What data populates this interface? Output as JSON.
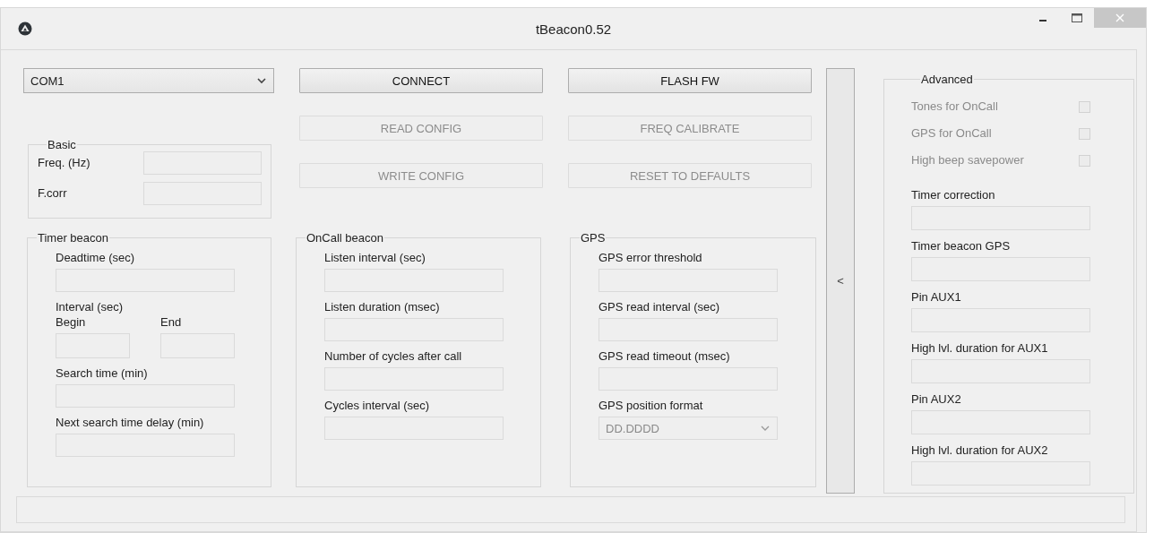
{
  "window": {
    "title": "tBeacon0.52"
  },
  "port": {
    "value": "COM1"
  },
  "buttons": [
    {
      "label": "CONNECT",
      "disabled": false
    },
    {
      "label": "FLASH FW",
      "disabled": false
    },
    {
      "label": "READ CONFIG",
      "disabled": true
    },
    {
      "label": "FREQ CALIBRATE",
      "disabled": true
    },
    {
      "label": "WRITE CONFIG",
      "disabled": true
    },
    {
      "label": "RESET TO DEFAULTS",
      "disabled": true
    }
  ],
  "basic": {
    "title": "Basic",
    "fields": [
      {
        "label": "Freq. (Hz)"
      },
      {
        "label": "F.corr"
      }
    ]
  },
  "timer_beacon": {
    "title": "Timer beacon",
    "fields": [
      {
        "kind": "field",
        "label": "Deadtime (sec)"
      },
      {
        "kind": "pair",
        "label": "Interval (sec)",
        "fields": [
          {
            "label": "Begin"
          },
          {
            "label": "End"
          }
        ]
      },
      {
        "kind": "field",
        "label": "Search time (min)"
      },
      {
        "kind": "field",
        "label": "Next search time delay (min)"
      }
    ]
  },
  "oncall_beacon": {
    "title": "OnCall beacon",
    "fields": [
      {
        "kind": "field",
        "label": "Listen interval (sec)"
      },
      {
        "kind": "field",
        "label": "Listen duration (msec)"
      },
      {
        "kind": "field",
        "label": "Number of cycles after call"
      },
      {
        "kind": "field",
        "label": "Cycles interval (sec)"
      }
    ]
  },
  "gps": {
    "title": "GPS",
    "fields": [
      {
        "kind": "field",
        "label": "GPS error threshold"
      },
      {
        "kind": "field",
        "label": "GPS read interval (sec)"
      },
      {
        "kind": "field",
        "label": "GPS read timeout (msec)"
      },
      {
        "kind": "select",
        "label": "GPS position format",
        "value": "DD.DDDD",
        "disabled": true
      }
    ]
  },
  "collapse_button": {
    "label": "<"
  },
  "advanced": {
    "title": "Advanced",
    "options": [
      {
        "label": "Tones for OnCall",
        "checked": false,
        "disabled": true
      },
      {
        "label": "GPS for OnCall",
        "checked": false,
        "disabled": true
      },
      {
        "label": "High beep savepower",
        "checked": false,
        "disabled": true
      }
    ],
    "fields": [
      {
        "label": "Timer correction"
      },
      {
        "label": "Timer beacon GPS"
      },
      {
        "label": "Pin AUX1"
      },
      {
        "label": "High lvl. duration for AUX1"
      },
      {
        "label": "Pin AUX2"
      },
      {
        "label": "High lvl. duration for AUX2"
      }
    ]
  }
}
